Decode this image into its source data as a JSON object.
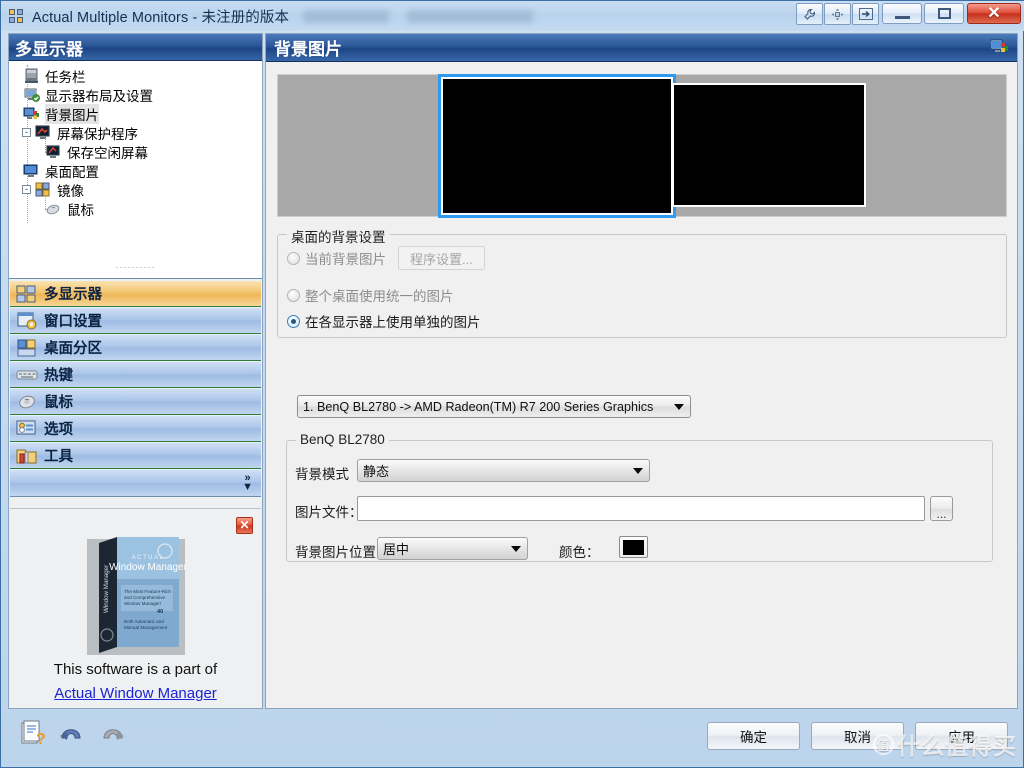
{
  "window": {
    "title": "Actual Multiple Monitors - 未注册的版本",
    "app_icon": "multi-monitor-icon",
    "extra_buttons": [
      {
        "name": "settings-wrench-button",
        "glyph": "⑂"
      },
      {
        "name": "move-window-button",
        "glyph": "✥"
      },
      {
        "name": "send-to-monitor-button",
        "glyph": "⇥"
      }
    ],
    "system_buttons": [
      {
        "name": "minimize-button",
        "glyph": "—"
      },
      {
        "name": "maximize-button",
        "glyph": "▭"
      },
      {
        "name": "close-button",
        "glyph": "✕"
      }
    ]
  },
  "tree": {
    "header": "多显示器",
    "items": [
      {
        "label": "任务栏",
        "icon": "taskbar-icon",
        "level": 0,
        "expander": null,
        "selected": false
      },
      {
        "label": "显示器布局及设置",
        "icon": "monitor-layout-icon",
        "level": 0,
        "expander": null,
        "selected": false
      },
      {
        "label": "背景图片",
        "icon": "wallpaper-icon",
        "level": 0,
        "expander": null,
        "selected": true
      },
      {
        "label": "屏幕保护程序",
        "icon": "screensaver-icon",
        "level": 0,
        "expander": "-",
        "selected": false
      },
      {
        "label": "保存空闲屏幕",
        "icon": "idle-screen-icon",
        "level": 1,
        "expander": null,
        "selected": false
      },
      {
        "label": "桌面配置",
        "icon": "desktop-profile-icon",
        "level": 0,
        "expander": null,
        "selected": false
      },
      {
        "label": "镜像",
        "icon": "mirror-icon",
        "level": 0,
        "expander": "-",
        "selected": false
      },
      {
        "label": "鼠标",
        "icon": "mouse-icon",
        "level": 1,
        "expander": null,
        "selected": false
      }
    ]
  },
  "nav": {
    "items": [
      {
        "label": "多显示器",
        "icon": "multi-monitor-icon",
        "active": true
      },
      {
        "label": "窗口设置",
        "icon": "window-settings-icon",
        "active": false
      },
      {
        "label": "桌面分区",
        "icon": "desktop-divider-icon",
        "active": false
      },
      {
        "label": "热键",
        "icon": "hotkeys-icon",
        "active": false
      },
      {
        "label": "鼠标",
        "icon": "mouse-icon",
        "active": false
      },
      {
        "label": "选项",
        "icon": "options-icon",
        "active": false
      },
      {
        "label": "工具",
        "icon": "tools-icon",
        "active": false
      }
    ],
    "more_glyph": "»"
  },
  "promo": {
    "close_glyph": "✕",
    "box_brand": "ACTUAL",
    "box_title": "Window Manager",
    "box_spine": "Window Manager",
    "box_tag1": "The Most Feature-Rich and Comprehensive Window Manager!",
    "box_tag2": "More Than 40 Handy Tools!",
    "box_tag3": "Both Automatic and Manual Management",
    "caption": "This software is a part of",
    "link": "Actual Window Manager"
  },
  "panel": {
    "title": "背景图片",
    "header_icon": "wallpaper-icon",
    "monitors": [
      {
        "name": "monitor-1-preview",
        "selected": true
      },
      {
        "name": "monitor-2-preview",
        "selected": false
      }
    ]
  },
  "desktop_bg_group": {
    "title": "桌面的背景设置",
    "options": [
      {
        "label": "当前背景图片",
        "selected": false,
        "disabled": true
      },
      {
        "label": "整个桌面使用统一的图片",
        "selected": false,
        "disabled": true
      },
      {
        "label": "在各显示器上使用单独的图片",
        "selected": true,
        "disabled": false
      }
    ],
    "program_settings_button": "程序设置...",
    "monitor_select_value": "1. BenQ BL2780 -> AMD Radeon(TM) R7 200 Series Graphics"
  },
  "monitor_group": {
    "title": "BenQ BL2780",
    "mode_label": "背景模式",
    "mode_value": "静态",
    "file_label": "图片文件：",
    "file_value": "",
    "browse_glyph": "...",
    "position_label": "背景图片位置：",
    "position_value": "居中",
    "color_label": "颜色：",
    "color_value": "#000000"
  },
  "bottombar": {
    "icons": [
      {
        "name": "help-icon",
        "glyph": "?"
      },
      {
        "name": "undo-icon",
        "glyph": "↶"
      },
      {
        "name": "redo-icon",
        "glyph": "↷"
      }
    ],
    "buttons": [
      {
        "name": "ok-button",
        "label": "确定"
      },
      {
        "name": "cancel-button",
        "label": "取消"
      },
      {
        "name": "apply-button",
        "label": "应用"
      }
    ]
  },
  "watermark": {
    "badge": "值",
    "text": "什么值得买"
  },
  "colors": {
    "accent_blue": "#2a5596",
    "active_orange": "#f3c571",
    "nav_blue": "#a8c3e8",
    "link_blue": "#1a23d8",
    "selection_border": "#2e9bf0"
  }
}
